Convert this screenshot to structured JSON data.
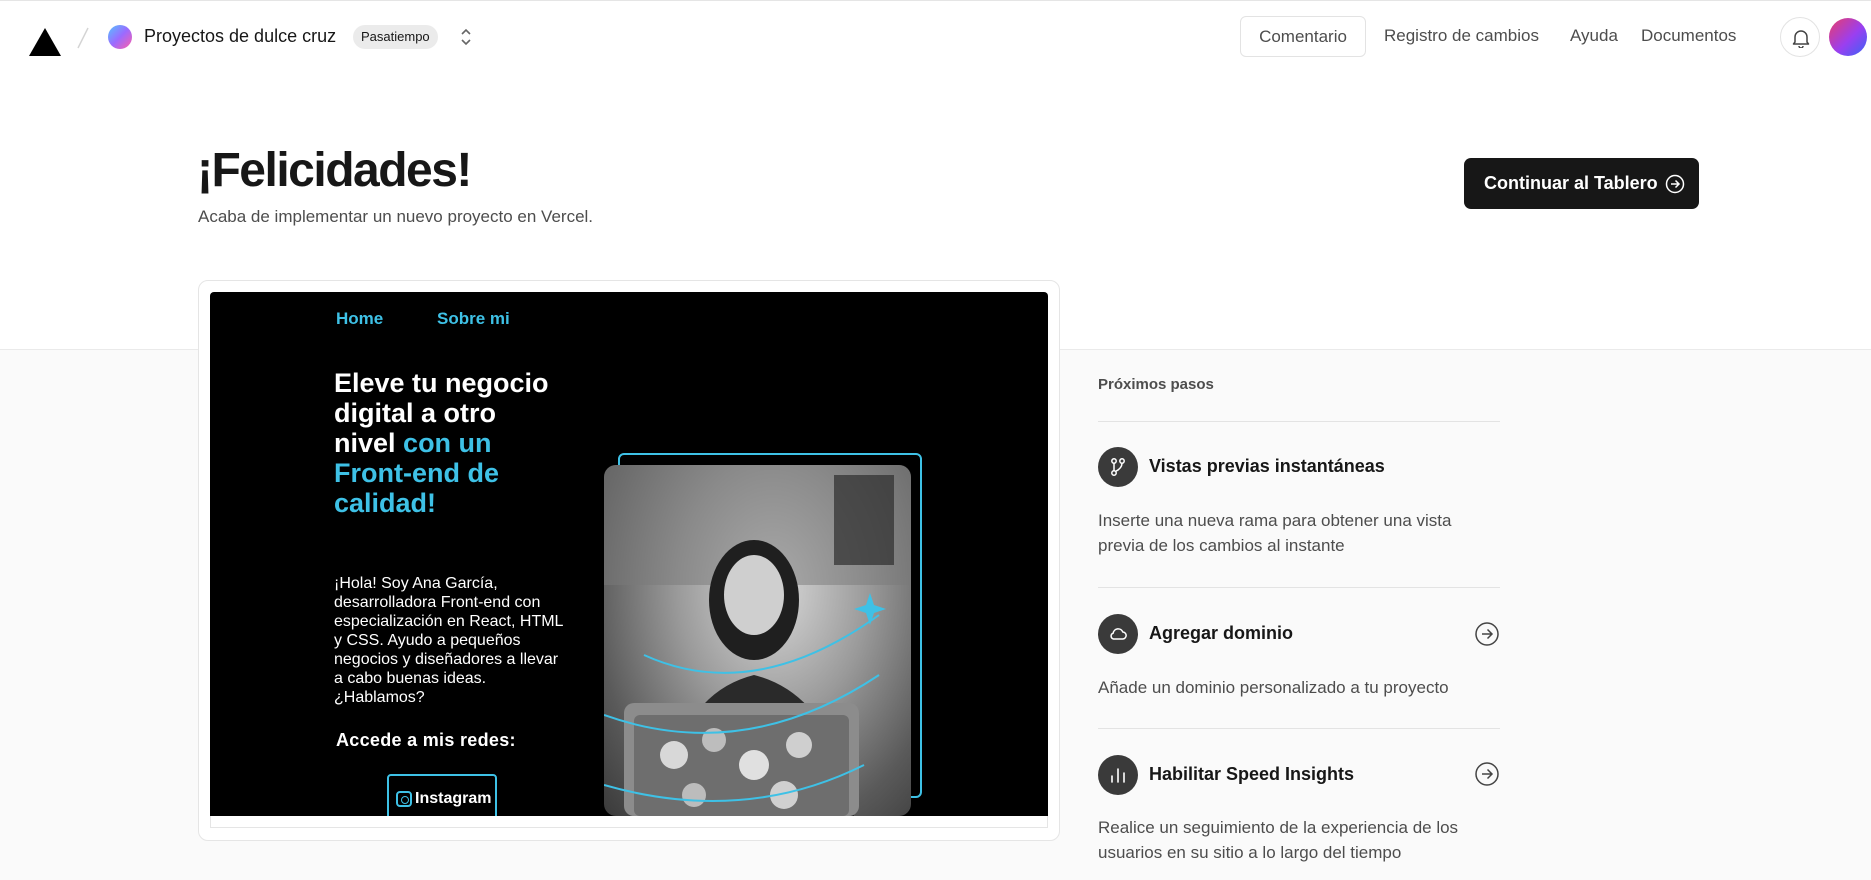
{
  "header": {
    "team_name": "Proyectos de dulce cruz",
    "plan_badge": "Pasatiempo",
    "feedback_label": "Comentario",
    "nav": [
      "Registro de cambios",
      "Ayuda",
      "Documentos"
    ]
  },
  "hero": {
    "title": "¡Felicidades!",
    "subtitle": "Acaba de implementar un nuevo proyecto en Vercel.",
    "continue_label": "Continuar al Tablero"
  },
  "preview": {
    "nav": [
      "Home",
      "Sobre mi"
    ],
    "headline_white": "Eleve tu negocio digital a otro nivel",
    "headline_accent": "con un Front-end de calidad!",
    "intro": "¡Hola! Soy Ana García, desarrolladora Front-end con especialización en React, HTML y CSS. Ayudo a pequeños negocios y diseñadores a llevar a cabo buenas ideas. ¿Hablamos?",
    "social_heading": "Accede a mis redes:",
    "instagram_label": "Instagram",
    "accent_color": "#3ec1e6"
  },
  "next_steps": {
    "title": "Próximos pasos",
    "items": [
      {
        "title": "Vistas previas instantáneas",
        "description": "Inserte una nueva rama para obtener una vista previa de los cambios al instante",
        "icon": "git-branch-icon"
      },
      {
        "title": "Agregar dominio",
        "description": "Añade un dominio personalizado a tu proyecto",
        "icon": "cloud-icon"
      },
      {
        "title": "Habilitar Speed Insights",
        "description": "Realice un seguimiento de la experiencia de los usuarios en su sitio a lo largo del tiempo",
        "icon": "bar-chart-icon"
      }
    ]
  }
}
